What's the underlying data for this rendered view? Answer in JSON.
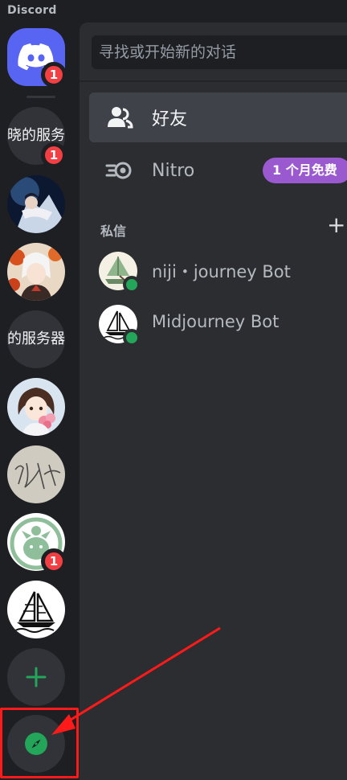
{
  "app": {
    "brand": "Discord"
  },
  "rail": {
    "home_badge": "1",
    "servers": [
      {
        "type": "text",
        "label": "晓的服务",
        "badge": "1"
      },
      {
        "type": "image",
        "icon": "anime-art-server-icon"
      },
      {
        "type": "image",
        "icon": "anime-girl-server-icon"
      },
      {
        "type": "text",
        "label": "的服务器",
        "badge": ""
      },
      {
        "type": "image",
        "icon": "chibi-girl-server-icon"
      },
      {
        "type": "image",
        "icon": "handwriting-server-icon"
      },
      {
        "type": "image",
        "icon": "green-mascot-server-icon",
        "badge": "1"
      },
      {
        "type": "image",
        "icon": "sailboat-server-icon"
      }
    ]
  },
  "search": {
    "placeholder": "寻找或开始新的对话"
  },
  "nav": {
    "friends": "好友",
    "nitro": "Nitro",
    "nitro_promo": "1 个月免费"
  },
  "dms": {
    "header": "私信",
    "add": "+",
    "items": [
      {
        "name": "niji・journey Bot",
        "status": "online"
      },
      {
        "name": "Midjourney Bot",
        "status": "online"
      }
    ]
  },
  "colors": {
    "accent": "#5865f2",
    "online": "#23a55a",
    "badge": "#f23f43",
    "nitro": "#9b59d0",
    "annotation": "#ff1a1a"
  }
}
